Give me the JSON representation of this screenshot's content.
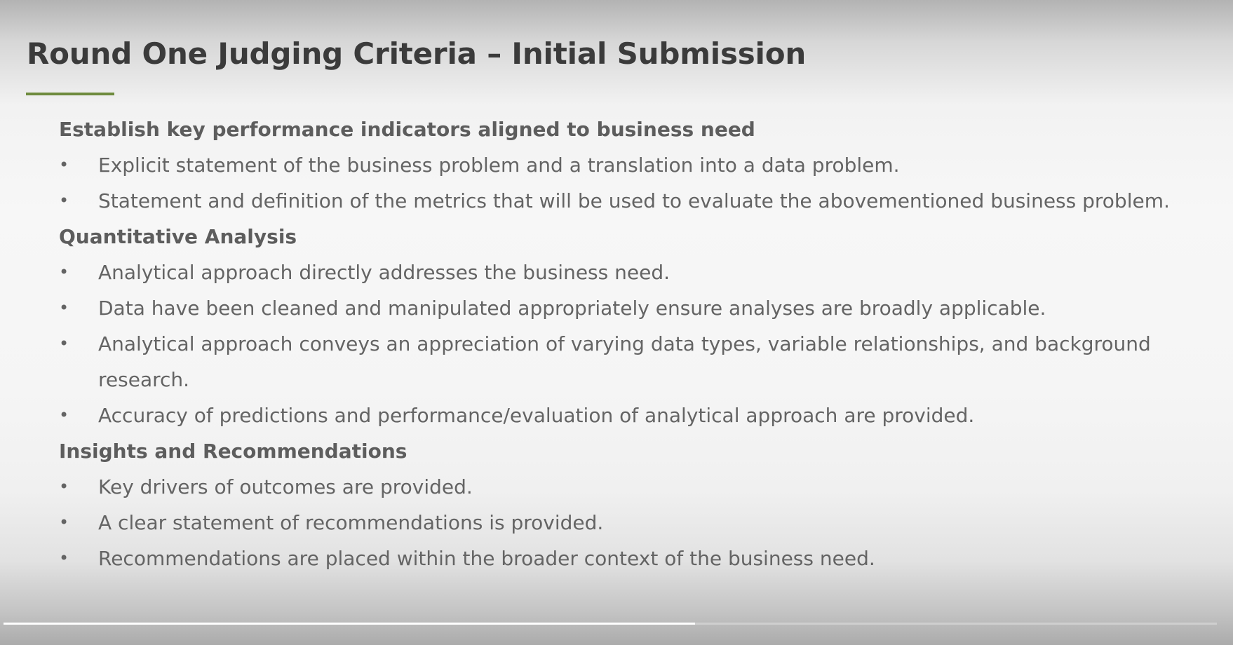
{
  "slide": {
    "title": "Round One Judging Criteria – Initial Submission",
    "bullet_glyph": "•",
    "accent_color": "#6e8b3d",
    "sections": [
      {
        "heading": "Establish key performance indicators aligned to business need",
        "items": [
          "Explicit statement of the business problem and a translation into a data problem.",
          "Statement and definition of the metrics that will be used to evaluate the abovementioned business problem."
        ]
      },
      {
        "heading": "Quantitative Analysis",
        "items": [
          "Analytical approach directly addresses the business need.",
          "Data have been cleaned and manipulated appropriately ensure analyses are broadly applicable.",
          "Analytical approach conveys an appreciation of varying data types, variable relationships, and background research.",
          "Accuracy of predictions and performance/evaluation of analytical approach are provided."
        ]
      },
      {
        "heading": "Insights and Recommendations",
        "items": [
          "Key drivers of outcomes are provided.",
          "A clear statement of recommendations is provided.",
          "Recommendations are placed within the broader context of the business need."
        ]
      }
    ]
  },
  "playback": {
    "progress": 0.57
  }
}
